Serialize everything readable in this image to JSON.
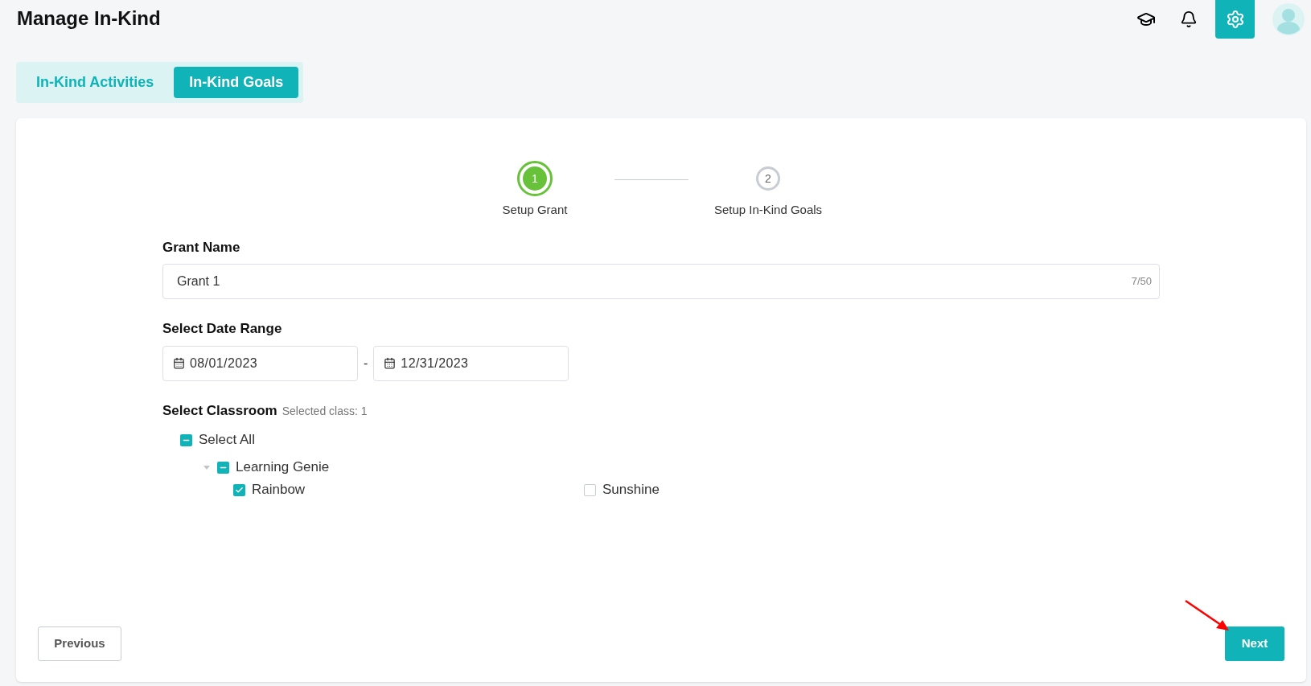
{
  "page_title": "Manage In-Kind",
  "tabs": [
    {
      "label": "In-Kind Activities",
      "selected": false
    },
    {
      "label": "In-Kind Goals",
      "selected": true
    }
  ],
  "stepper": [
    {
      "number": "1",
      "label": "Setup Grant",
      "active": true
    },
    {
      "number": "2",
      "label": "Setup In-Kind Goals",
      "active": false
    }
  ],
  "grant_name": {
    "label": "Grant Name",
    "value": "Grant 1",
    "counter": "7/50"
  },
  "date_range": {
    "label": "Select Date Range",
    "start": "08/01/2023",
    "separator": "-",
    "end": "12/31/2023"
  },
  "classroom": {
    "label": "Select Classroom",
    "summary": "Selected class: 1",
    "tree": [
      {
        "label": "Select All",
        "checked": true,
        "indeterminate": true,
        "children": [
          {
            "label": "Learning Genie",
            "checked": true,
            "indeterminate": true,
            "expanded": true,
            "children": [
              {
                "label": "Rainbow",
                "checked": true
              },
              {
                "label": "Sunshine",
                "checked": false
              }
            ]
          }
        ]
      }
    ]
  },
  "buttons": {
    "previous": "Previous",
    "next": "Next"
  }
}
